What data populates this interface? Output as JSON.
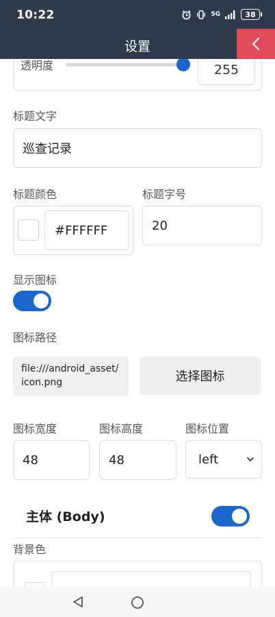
{
  "status_bar": {
    "time": "10:22",
    "network": "5G",
    "battery": "38",
    "icons": [
      "alarm-icon",
      "vibrate-icon",
      "signal-icon",
      "battery-icon"
    ]
  },
  "header": {
    "title": "设置",
    "back_icon": "chevron-left-icon",
    "background_color": "#2f3b4d",
    "back_button_color": "#e04a5a"
  },
  "form": {
    "opacity": {
      "label": "透明度",
      "value": "255",
      "slider_fraction": 1.0
    },
    "title_text": {
      "label": "标题文字",
      "value": "巡查记录"
    },
    "title_color": {
      "label": "标题颜色",
      "value": "#FFFFFF"
    },
    "title_font_size": {
      "label": "标题字号",
      "value": "20"
    },
    "show_icon": {
      "label": "显示图标",
      "enabled": true
    },
    "icon_path": {
      "label": "图标路径",
      "value": "file:///android_asset/icon.png"
    },
    "choose_icon_button": {
      "label": "选择图标"
    },
    "icon_width": {
      "label": "图标宽度",
      "value": "48"
    },
    "icon_height": {
      "label": "图标高度",
      "value": "48"
    },
    "icon_position": {
      "label": "图标位置",
      "value": "left"
    },
    "body_section": {
      "title": "主体 (Body)",
      "enabled": true
    },
    "background_color": {
      "label": "背景色"
    }
  },
  "accent_color": "#1a66cc",
  "nav_bar": {
    "icons": [
      "nav-back-icon",
      "nav-home-icon"
    ]
  }
}
